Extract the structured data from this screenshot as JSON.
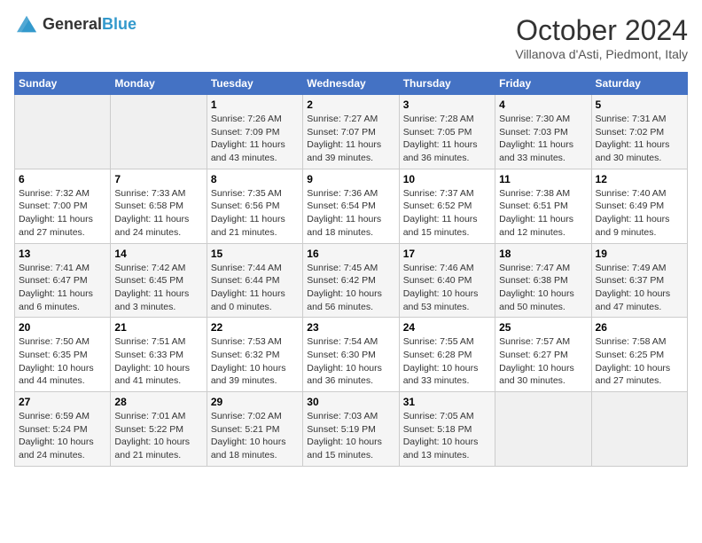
{
  "header": {
    "logo_general": "General",
    "logo_blue": "Blue",
    "title": "October 2024",
    "subtitle": "Villanova d'Asti, Piedmont, Italy"
  },
  "days_of_week": [
    "Sunday",
    "Monday",
    "Tuesday",
    "Wednesday",
    "Thursday",
    "Friday",
    "Saturday"
  ],
  "weeks": [
    [
      {
        "day": "",
        "sunrise": "",
        "sunset": "",
        "daylight": ""
      },
      {
        "day": "",
        "sunrise": "",
        "sunset": "",
        "daylight": ""
      },
      {
        "day": "1",
        "sunrise": "Sunrise: 7:26 AM",
        "sunset": "Sunset: 7:09 PM",
        "daylight": "Daylight: 11 hours and 43 minutes."
      },
      {
        "day": "2",
        "sunrise": "Sunrise: 7:27 AM",
        "sunset": "Sunset: 7:07 PM",
        "daylight": "Daylight: 11 hours and 39 minutes."
      },
      {
        "day": "3",
        "sunrise": "Sunrise: 7:28 AM",
        "sunset": "Sunset: 7:05 PM",
        "daylight": "Daylight: 11 hours and 36 minutes."
      },
      {
        "day": "4",
        "sunrise": "Sunrise: 7:30 AM",
        "sunset": "Sunset: 7:03 PM",
        "daylight": "Daylight: 11 hours and 33 minutes."
      },
      {
        "day": "5",
        "sunrise": "Sunrise: 7:31 AM",
        "sunset": "Sunset: 7:02 PM",
        "daylight": "Daylight: 11 hours and 30 minutes."
      }
    ],
    [
      {
        "day": "6",
        "sunrise": "Sunrise: 7:32 AM",
        "sunset": "Sunset: 7:00 PM",
        "daylight": "Daylight: 11 hours and 27 minutes."
      },
      {
        "day": "7",
        "sunrise": "Sunrise: 7:33 AM",
        "sunset": "Sunset: 6:58 PM",
        "daylight": "Daylight: 11 hours and 24 minutes."
      },
      {
        "day": "8",
        "sunrise": "Sunrise: 7:35 AM",
        "sunset": "Sunset: 6:56 PM",
        "daylight": "Daylight: 11 hours and 21 minutes."
      },
      {
        "day": "9",
        "sunrise": "Sunrise: 7:36 AM",
        "sunset": "Sunset: 6:54 PM",
        "daylight": "Daylight: 11 hours and 18 minutes."
      },
      {
        "day": "10",
        "sunrise": "Sunrise: 7:37 AM",
        "sunset": "Sunset: 6:52 PM",
        "daylight": "Daylight: 11 hours and 15 minutes."
      },
      {
        "day": "11",
        "sunrise": "Sunrise: 7:38 AM",
        "sunset": "Sunset: 6:51 PM",
        "daylight": "Daylight: 11 hours and 12 minutes."
      },
      {
        "day": "12",
        "sunrise": "Sunrise: 7:40 AM",
        "sunset": "Sunset: 6:49 PM",
        "daylight": "Daylight: 11 hours and 9 minutes."
      }
    ],
    [
      {
        "day": "13",
        "sunrise": "Sunrise: 7:41 AM",
        "sunset": "Sunset: 6:47 PM",
        "daylight": "Daylight: 11 hours and 6 minutes."
      },
      {
        "day": "14",
        "sunrise": "Sunrise: 7:42 AM",
        "sunset": "Sunset: 6:45 PM",
        "daylight": "Daylight: 11 hours and 3 minutes."
      },
      {
        "day": "15",
        "sunrise": "Sunrise: 7:44 AM",
        "sunset": "Sunset: 6:44 PM",
        "daylight": "Daylight: 11 hours and 0 minutes."
      },
      {
        "day": "16",
        "sunrise": "Sunrise: 7:45 AM",
        "sunset": "Sunset: 6:42 PM",
        "daylight": "Daylight: 10 hours and 56 minutes."
      },
      {
        "day": "17",
        "sunrise": "Sunrise: 7:46 AM",
        "sunset": "Sunset: 6:40 PM",
        "daylight": "Daylight: 10 hours and 53 minutes."
      },
      {
        "day": "18",
        "sunrise": "Sunrise: 7:47 AM",
        "sunset": "Sunset: 6:38 PM",
        "daylight": "Daylight: 10 hours and 50 minutes."
      },
      {
        "day": "19",
        "sunrise": "Sunrise: 7:49 AM",
        "sunset": "Sunset: 6:37 PM",
        "daylight": "Daylight: 10 hours and 47 minutes."
      }
    ],
    [
      {
        "day": "20",
        "sunrise": "Sunrise: 7:50 AM",
        "sunset": "Sunset: 6:35 PM",
        "daylight": "Daylight: 10 hours and 44 minutes."
      },
      {
        "day": "21",
        "sunrise": "Sunrise: 7:51 AM",
        "sunset": "Sunset: 6:33 PM",
        "daylight": "Daylight: 10 hours and 41 minutes."
      },
      {
        "day": "22",
        "sunrise": "Sunrise: 7:53 AM",
        "sunset": "Sunset: 6:32 PM",
        "daylight": "Daylight: 10 hours and 39 minutes."
      },
      {
        "day": "23",
        "sunrise": "Sunrise: 7:54 AM",
        "sunset": "Sunset: 6:30 PM",
        "daylight": "Daylight: 10 hours and 36 minutes."
      },
      {
        "day": "24",
        "sunrise": "Sunrise: 7:55 AM",
        "sunset": "Sunset: 6:28 PM",
        "daylight": "Daylight: 10 hours and 33 minutes."
      },
      {
        "day": "25",
        "sunrise": "Sunrise: 7:57 AM",
        "sunset": "Sunset: 6:27 PM",
        "daylight": "Daylight: 10 hours and 30 minutes."
      },
      {
        "day": "26",
        "sunrise": "Sunrise: 7:58 AM",
        "sunset": "Sunset: 6:25 PM",
        "daylight": "Daylight: 10 hours and 27 minutes."
      }
    ],
    [
      {
        "day": "27",
        "sunrise": "Sunrise: 6:59 AM",
        "sunset": "Sunset: 5:24 PM",
        "daylight": "Daylight: 10 hours and 24 minutes."
      },
      {
        "day": "28",
        "sunrise": "Sunrise: 7:01 AM",
        "sunset": "Sunset: 5:22 PM",
        "daylight": "Daylight: 10 hours and 21 minutes."
      },
      {
        "day": "29",
        "sunrise": "Sunrise: 7:02 AM",
        "sunset": "Sunset: 5:21 PM",
        "daylight": "Daylight: 10 hours and 18 minutes."
      },
      {
        "day": "30",
        "sunrise": "Sunrise: 7:03 AM",
        "sunset": "Sunset: 5:19 PM",
        "daylight": "Daylight: 10 hours and 15 minutes."
      },
      {
        "day": "31",
        "sunrise": "Sunrise: 7:05 AM",
        "sunset": "Sunset: 5:18 PM",
        "daylight": "Daylight: 10 hours and 13 minutes."
      },
      {
        "day": "",
        "sunrise": "",
        "sunset": "",
        "daylight": ""
      },
      {
        "day": "",
        "sunrise": "",
        "sunset": "",
        "daylight": ""
      }
    ]
  ]
}
